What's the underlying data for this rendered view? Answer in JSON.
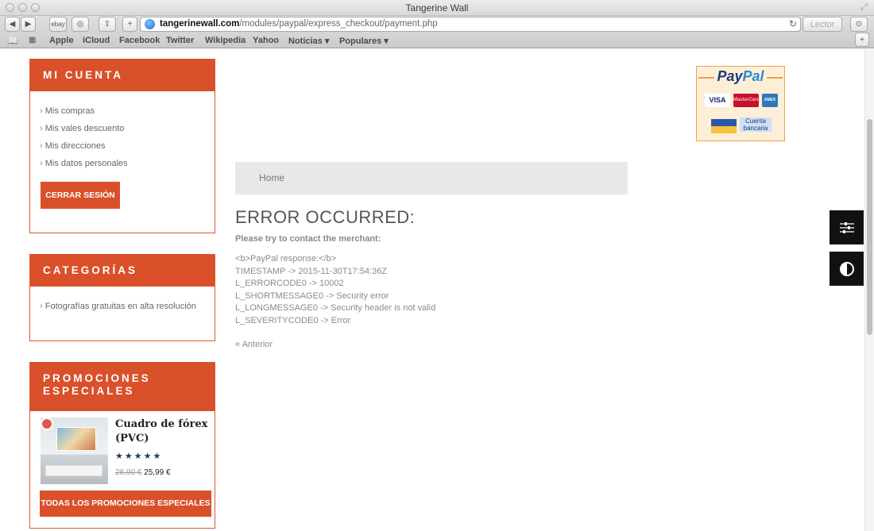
{
  "browser": {
    "window_title": "Tangerine Wall",
    "url_host": "tangerinewall.com",
    "url_path": "/modules/paypal/express_checkout/payment.php",
    "reader_label": "Lector",
    "ebay_label": "ebay",
    "bookmarks": [
      "Apple",
      "iCloud",
      "Facebook",
      "Twitter",
      "Wikipedia",
      "Yahoo",
      "Noticias ▾",
      "Populares ▾"
    ]
  },
  "account": {
    "title": "MI CUENTA",
    "links": [
      "Mis compras",
      "Mis vales descuento",
      "Mis direcciones",
      "Mis datos personales"
    ],
    "logout_label": "CERRAR SESIÓN"
  },
  "categories": {
    "title": "CATEGORÍAS",
    "links": [
      "Fotografías gratuitas en alta resolución"
    ]
  },
  "promotions": {
    "title_line1": "PROMOCIONES",
    "title_line2": "ESPECIALES",
    "product_name": "Cuadro de fórex (PVC)",
    "stars": "★★★★★",
    "rating": 5,
    "old_price": "28,90 €",
    "new_price": "25,99 €",
    "all_button": "TODAS LOS PROMOCIONES ESPECIALES"
  },
  "paypal": {
    "logo_part1": "Pay",
    "logo_part2": "Pal",
    "cards": [
      "VISA",
      "MasterCard",
      "AMEX"
    ],
    "bank_label": "Cuenta bancaria"
  },
  "breadcrumb": {
    "home": "Home"
  },
  "error": {
    "title": "ERROR OCCURRED:",
    "subtitle": "Please try to contact the merchant:",
    "lines": [
      "<b>PayPal response:</b>",
      "TIMESTAMP -> 2015-11-30T17:54:36Z",
      "L_ERRORCODE0 -> 10002",
      "L_SHORTMESSAGE0 -> Security error",
      "L_LONGMESSAGE0 -> Security header is not valid",
      "L_SEVERITYCODE0 -> Error"
    ],
    "previous_link": "« Anterior"
  },
  "side_tools": {
    "settings_icon": "☰",
    "contrast_icon": "◐"
  },
  "colors": {
    "accent": "#d9502a",
    "paypal_border": "#f0a04b"
  }
}
